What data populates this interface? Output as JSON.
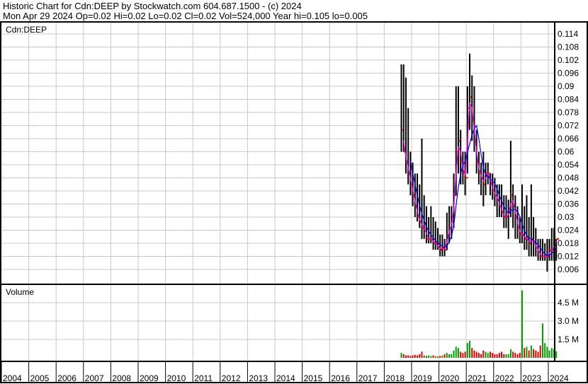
{
  "header": {
    "line1": "Historic Chart for Cdn:DEEP by Stockwatch.com 604.687.1500 - (c) 2024",
    "line2": "Mon Apr 29 2024  Op=0.02  Hi=0.02  Lo=0.02  Cl=0.02  Vol=524,000  Year hi=0.105  lo=0.005"
  },
  "colors": {
    "bar": "#000000",
    "close": "#ff0000",
    "ma_short": "#ff00ff",
    "ma_long": "#0000ff",
    "vol_up": "#00a000",
    "vol_down": "#e00000",
    "grid": "#c8c8c8"
  },
  "chart_data": [
    {
      "type": "line",
      "title": "Cdn:DEEP",
      "ylim": [
        0,
        0.12
      ],
      "y_ticks": [
        "0.114",
        "0.108",
        "0.102",
        "0.096",
        "0.09",
        "0.084",
        "0.078",
        "0.072",
        "0.066",
        "0.06",
        "0.054",
        "0.048",
        "0.042",
        "0.036",
        "0.03",
        "0.024",
        "0.018",
        "0.012",
        "0.006"
      ],
      "x_ticks": [
        "2004",
        "2005",
        "2006",
        "2007",
        "2008",
        "2009",
        "2010",
        "2011",
        "2012",
        "2013",
        "2014",
        "2015",
        "2016",
        "2017",
        "2018",
        "2019",
        "2020",
        "2021",
        "2022",
        "2023",
        "2024"
      ],
      "start": [
        2018,
        8
      ],
      "series": [
        {
          "name": "high",
          "values": [
            0.1,
            0.1,
            0.094,
            0.08,
            0.06,
            0.055,
            0.05,
            0.05,
            0.045,
            0.066,
            0.04,
            0.035,
            0.03,
            0.035,
            0.03,
            0.028,
            0.025,
            0.022,
            0.022,
            0.02,
            0.032,
            0.035,
            0.035,
            0.05,
            0.09,
            0.09,
            0.07,
            0.06,
            0.06,
            0.09,
            0.105,
            0.095,
            0.09,
            0.07,
            0.06,
            0.055,
            0.06,
            0.055,
            0.055,
            0.05,
            0.05,
            0.048,
            0.045,
            0.045,
            0.045,
            0.04,
            0.04,
            0.038,
            0.065,
            0.045,
            0.04,
            0.035,
            0.03,
            0.045,
            0.035,
            0.04,
            0.03,
            0.045,
            0.03,
            0.025,
            0.02,
            0.02,
            0.02,
            0.018,
            0.02,
            0.02,
            0.025,
            0.025,
            0.02
          ]
        },
        {
          "name": "low",
          "values": [
            0.06,
            0.06,
            0.05,
            0.045,
            0.04,
            0.035,
            0.03,
            0.028,
            0.025,
            0.02,
            0.02,
            0.018,
            0.018,
            0.018,
            0.015,
            0.015,
            0.015,
            0.012,
            0.012,
            0.012,
            0.015,
            0.018,
            0.02,
            0.025,
            0.04,
            0.05,
            0.045,
            0.045,
            0.04,
            0.05,
            0.07,
            0.065,
            0.06,
            0.05,
            0.045,
            0.04,
            0.035,
            0.04,
            0.045,
            0.04,
            0.038,
            0.035,
            0.03,
            0.03,
            0.03,
            0.025,
            0.025,
            0.02,
            0.03,
            0.025,
            0.02,
            0.02,
            0.018,
            0.018,
            0.015,
            0.015,
            0.012,
            0.012,
            0.012,
            0.012,
            0.01,
            0.01,
            0.01,
            0.01,
            0.005,
            0.01,
            0.01,
            0.01,
            0.01
          ]
        },
        {
          "name": "close",
          "values": [
            0.07,
            0.06,
            0.055,
            0.05,
            0.045,
            0.04,
            0.035,
            0.03,
            0.028,
            0.025,
            0.025,
            0.02,
            0.02,
            0.02,
            0.018,
            0.018,
            0.016,
            0.015,
            0.016,
            0.015,
            0.022,
            0.025,
            0.028,
            0.04,
            0.06,
            0.065,
            0.055,
            0.05,
            0.048,
            0.08,
            0.085,
            0.075,
            0.065,
            0.055,
            0.05,
            0.048,
            0.045,
            0.05,
            0.05,
            0.045,
            0.042,
            0.04,
            0.038,
            0.035,
            0.032,
            0.03,
            0.03,
            0.032,
            0.04,
            0.035,
            0.03,
            0.025,
            0.022,
            0.022,
            0.02,
            0.02,
            0.018,
            0.02,
            0.018,
            0.016,
            0.014,
            0.012,
            0.012,
            0.012,
            0.012,
            0.015,
            0.015,
            0.018,
            0.02
          ]
        }
      ]
    },
    {
      "type": "bar",
      "title": "Volume",
      "y_ticks": [
        "4.5 M",
        "3.0 M",
        "1.5 M"
      ],
      "ylim": [
        0,
        6
      ],
      "start": [
        2018,
        8
      ],
      "values": [
        0.4,
        0.3,
        0.2,
        0.2,
        0.15,
        0.2,
        0.25,
        0.2,
        0.3,
        0.5,
        0.2,
        0.15,
        0.2,
        0.15,
        0.2,
        0.15,
        0.1,
        0.15,
        0.2,
        0.3,
        0.4,
        0.3,
        0.3,
        0.6,
        0.9,
        0.8,
        0.5,
        0.4,
        0.5,
        1.2,
        1.4,
        0.8,
        0.6,
        0.5,
        0.4,
        0.3,
        0.6,
        0.5,
        0.4,
        0.5,
        0.4,
        0.3,
        0.3,
        0.4,
        0.5,
        0.3,
        0.3,
        0.3,
        0.7,
        0.5,
        0.4,
        0.3,
        0.4,
        5.5,
        0.8,
        0.9,
        0.6,
        1.0,
        0.7,
        0.6,
        0.5,
        1.0,
        2.8,
        1.2,
        0.9,
        0.6,
        0.8,
        0.7,
        0.52
      ]
    }
  ]
}
